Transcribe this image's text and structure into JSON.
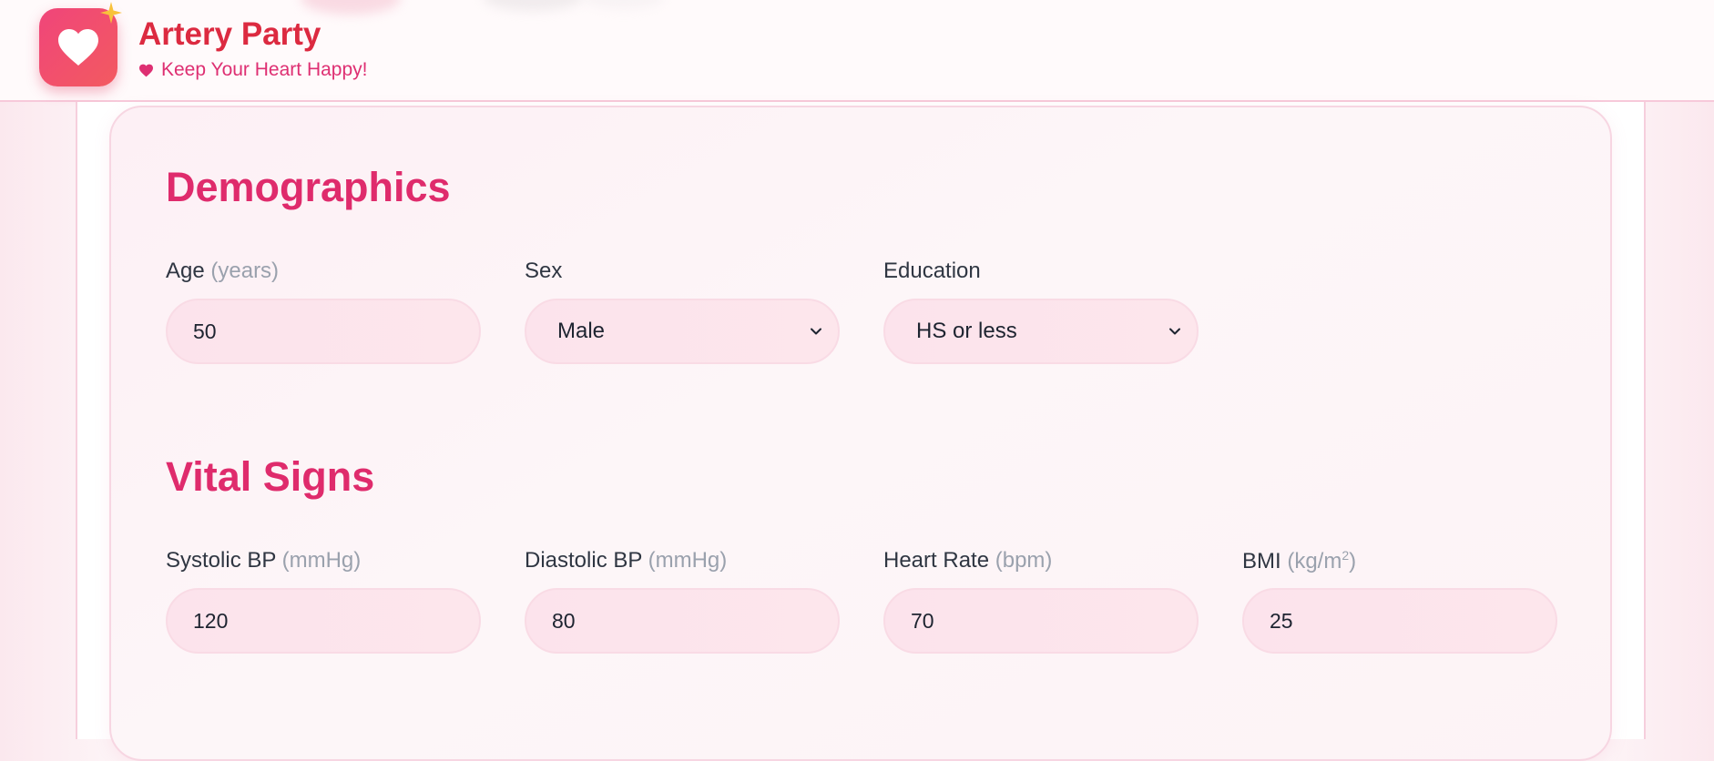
{
  "app": {
    "title": "Artery Party",
    "tagline": "Keep Your Heart Happy!",
    "brand_color": "#dc2a40",
    "accent_color": "#df2b6c",
    "logo_icon": "heart-icon",
    "sparkle_icon": "sparkle-icon"
  },
  "demographics": {
    "title": "Demographics",
    "age": {
      "label": "Age",
      "unit": "(years)",
      "value": "50"
    },
    "sex": {
      "label": "Sex",
      "value": "Male"
    },
    "education": {
      "label": "Education",
      "value": "HS or less"
    }
  },
  "vitals": {
    "title": "Vital Signs",
    "systolic": {
      "label": "Systolic BP",
      "unit": "(mmHg)",
      "value": "120"
    },
    "diastolic": {
      "label": "Diastolic BP",
      "unit": "(mmHg)",
      "value": "80"
    },
    "heart_rate": {
      "label": "Heart Rate",
      "unit": "(bpm)",
      "value": "70"
    },
    "bmi": {
      "label": "BMI",
      "unit_prefix": "(kg/m",
      "unit_sup": "2",
      "unit_suffix": ")",
      "value": "25"
    }
  }
}
